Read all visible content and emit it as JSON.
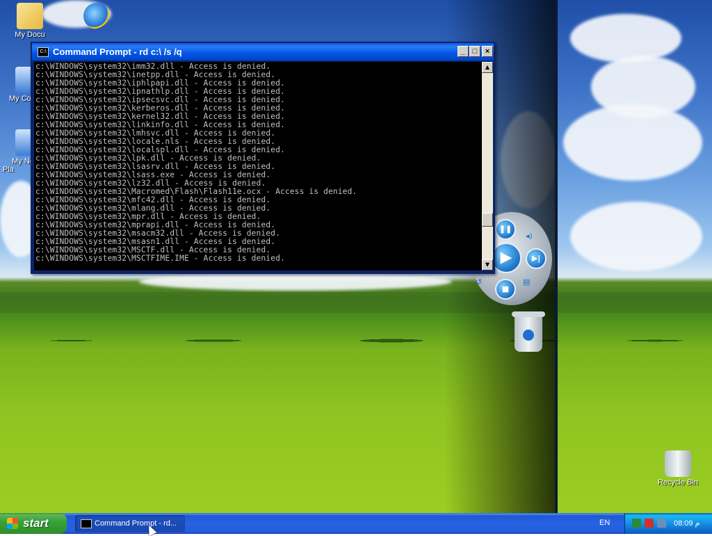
{
  "desktop": {
    "icons": [
      {
        "label": "My Documents",
        "visible_label": "My Docu"
      },
      {
        "label": "Internet Explorer",
        "visible_label": ""
      },
      {
        "label": "My Computer",
        "visible_label": "My Co"
      },
      {
        "label": "My Network Places",
        "visible_label": "My Ne\nPla"
      },
      {
        "label": "Recycle Bin",
        "visible_label": "Recycle Bin"
      }
    ]
  },
  "window": {
    "title": "Command Prompt - rd c:\\ /s /q",
    "controls": {
      "minimize": "_",
      "maximize": "□",
      "close": "×"
    },
    "console_lines": [
      "c:\\WINDOWS\\system32\\imm32.dll - Access is denied.",
      "c:\\WINDOWS\\system32\\inetpp.dll - Access is denied.",
      "c:\\WINDOWS\\system32\\iphlpapi.dll - Access is denied.",
      "c:\\WINDOWS\\system32\\ipnathlp.dll - Access is denied.",
      "c:\\WINDOWS\\system32\\ipsecsvc.dll - Access is denied.",
      "c:\\WINDOWS\\system32\\kerberos.dll - Access is denied.",
      "c:\\WINDOWS\\system32\\kernel32.dll - Access is denied.",
      "c:\\WINDOWS\\system32\\linkinfo.dll - Access is denied.",
      "c:\\WINDOWS\\system32\\lmhsvc.dll - Access is denied.",
      "c:\\WINDOWS\\system32\\locale.nls - Access is denied.",
      "c:\\WINDOWS\\system32\\localspl.dll - Access is denied.",
      "c:\\WINDOWS\\system32\\lpk.dll - Access is denied.",
      "c:\\WINDOWS\\system32\\lsasrv.dll - Access is denied.",
      "c:\\WINDOWS\\system32\\lsass.exe - Access is denied.",
      "c:\\WINDOWS\\system32\\lz32.dll - Access is denied.",
      "c:\\WINDOWS\\system32\\Macromed\\Flash\\Flash11e.ocx - Access is denied.",
      "c:\\WINDOWS\\system32\\mfc42.dll - Access is denied.",
      "c:\\WINDOWS\\system32\\mlang.dll - Access is denied.",
      "c:\\WINDOWS\\system32\\mpr.dll - Access is denied.",
      "c:\\WINDOWS\\system32\\mprapi.dll - Access is denied.",
      "c:\\WINDOWS\\system32\\msacm32.dll - Access is denied.",
      "c:\\WINDOWS\\system32\\msasn1.dll - Access is denied.",
      "c:\\WINDOWS\\system32\\MSCTF.dll - Access is denied.",
      "c:\\WINDOWS\\system32\\MSCTFIME.IME - Access is denied."
    ],
    "appicon_text": "C:\\"
  },
  "taskbar": {
    "start_label": "start",
    "task_label": "Command Prompt - rd...",
    "language": "EN",
    "clock": "08:09 م"
  }
}
